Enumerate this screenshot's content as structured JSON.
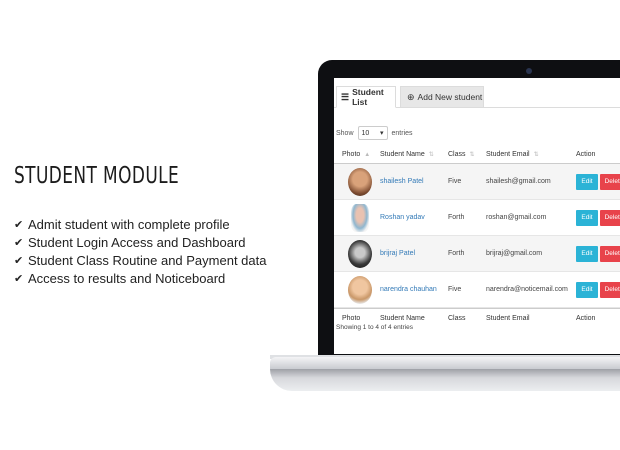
{
  "module": {
    "title": "STUDENT MODULE",
    "features": [
      "Admit student with complete profile",
      "Student Login Access and Dashboard",
      "Student Class Routine and Payment data",
      "Access to results and Noticeboard"
    ]
  },
  "tabs": [
    {
      "label": "Student List",
      "icon": "list-icon"
    },
    {
      "label": "Add New student",
      "icon": "plus-circle-icon"
    }
  ],
  "table_controls": {
    "show_label": "Show",
    "entries_value": "10",
    "entries_label": "entries"
  },
  "table": {
    "headers": [
      "Photo",
      "Student Name",
      "Class",
      "Student Email",
      "Action"
    ],
    "rows": [
      {
        "name": "shailesh Patel",
        "class": "Five",
        "email": "shailesh@gmail.com"
      },
      {
        "name": "Roshan yadav",
        "class": "Forth",
        "email": "roshan@gmail.com"
      },
      {
        "name": "brijraj Patel",
        "class": "Forth",
        "email": "brijraj@gmail.com"
      },
      {
        "name": "narendra chauhan",
        "class": "Five",
        "email": "narendra@noticemail.com"
      }
    ],
    "edit_label": "Edit",
    "delete_label": "Delete"
  },
  "table_info": "Showing 1 to 4 of 4 entries",
  "colors": {
    "edit": "#2bb3d6",
    "delete": "#e8434b",
    "link": "#337ab7"
  }
}
